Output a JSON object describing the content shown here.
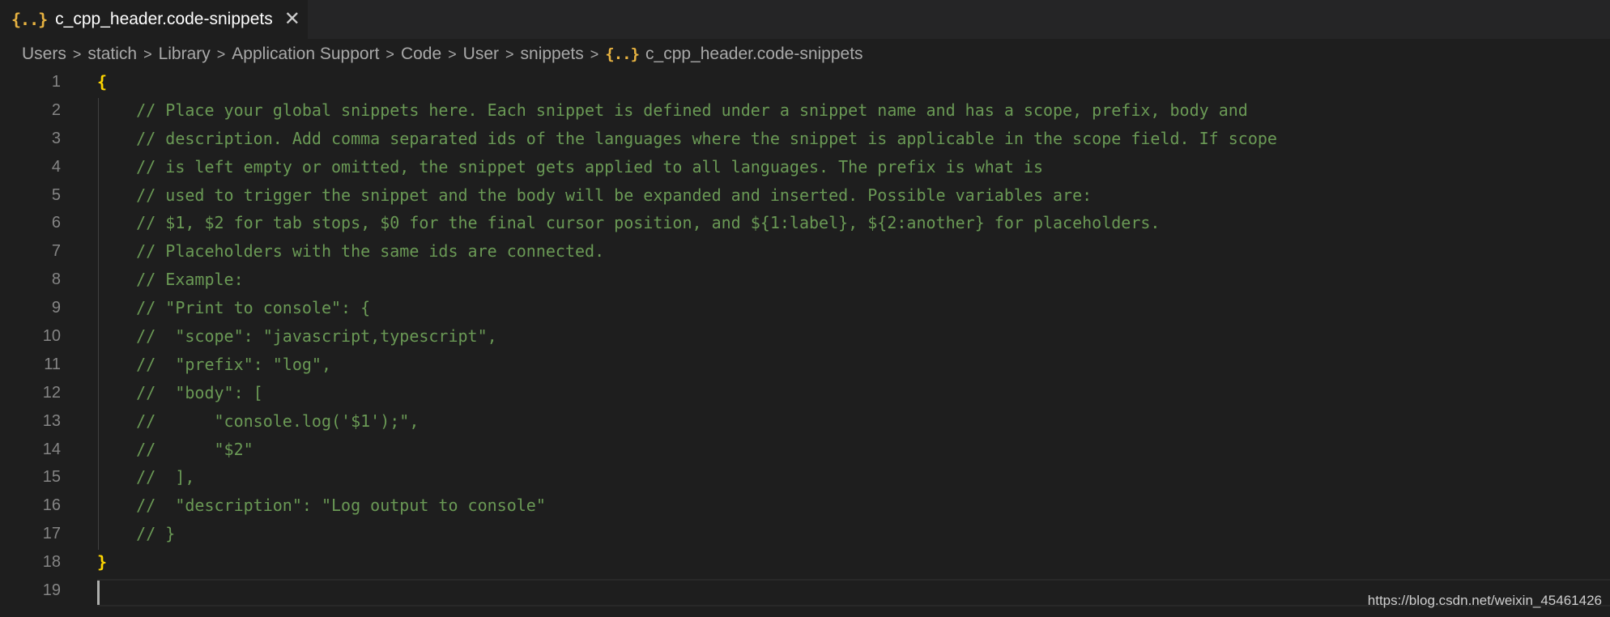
{
  "tab": {
    "icon": "{..}",
    "label": "c_cpp_header.code-snippets",
    "close": "✕"
  },
  "breadcrumb": {
    "separator": ">",
    "items": [
      "Users",
      "statich",
      "Library",
      "Application Support",
      "Code",
      "User",
      "snippets"
    ],
    "file_icon": "{..}",
    "file": "c_cpp_header.code-snippets"
  },
  "colors": {
    "comment": "#6a9955",
    "brace": "#ffd700",
    "line_number": "#858585",
    "file_icon": "#e8b341"
  },
  "lines": [
    {
      "n": "1",
      "text": "{"
    },
    {
      "n": "2",
      "text": "    // Place your global snippets here. Each snippet is defined under a snippet name and has a scope, prefix, body and"
    },
    {
      "n": "3",
      "text": "    // description. Add comma separated ids of the languages where the snippet is applicable in the scope field. If scope"
    },
    {
      "n": "4",
      "text": "    // is left empty or omitted, the snippet gets applied to all languages. The prefix is what is"
    },
    {
      "n": "5",
      "text": "    // used to trigger the snippet and the body will be expanded and inserted. Possible variables are:"
    },
    {
      "n": "6",
      "text": "    // $1, $2 for tab stops, $0 for the final cursor position, and ${1:label}, ${2:another} for placeholders."
    },
    {
      "n": "7",
      "text": "    // Placeholders with the same ids are connected."
    },
    {
      "n": "8",
      "text": "    // Example:"
    },
    {
      "n": "9",
      "text": "    // \"Print to console\": {"
    },
    {
      "n": "10",
      "text": "    //  \"scope\": \"javascript,typescript\","
    },
    {
      "n": "11",
      "text": "    //  \"prefix\": \"log\","
    },
    {
      "n": "12",
      "text": "    //  \"body\": ["
    },
    {
      "n": "13",
      "text": "    //      \"console.log('$1');\","
    },
    {
      "n": "14",
      "text": "    //      \"$2\""
    },
    {
      "n": "15",
      "text": "    //  ],"
    },
    {
      "n": "16",
      "text": "    //  \"description\": \"Log output to console\""
    },
    {
      "n": "17",
      "text": "    // }"
    },
    {
      "n": "18",
      "text": "}"
    },
    {
      "n": "19",
      "text": ""
    }
  ],
  "watermark": "https://blog.csdn.net/weixin_45461426"
}
